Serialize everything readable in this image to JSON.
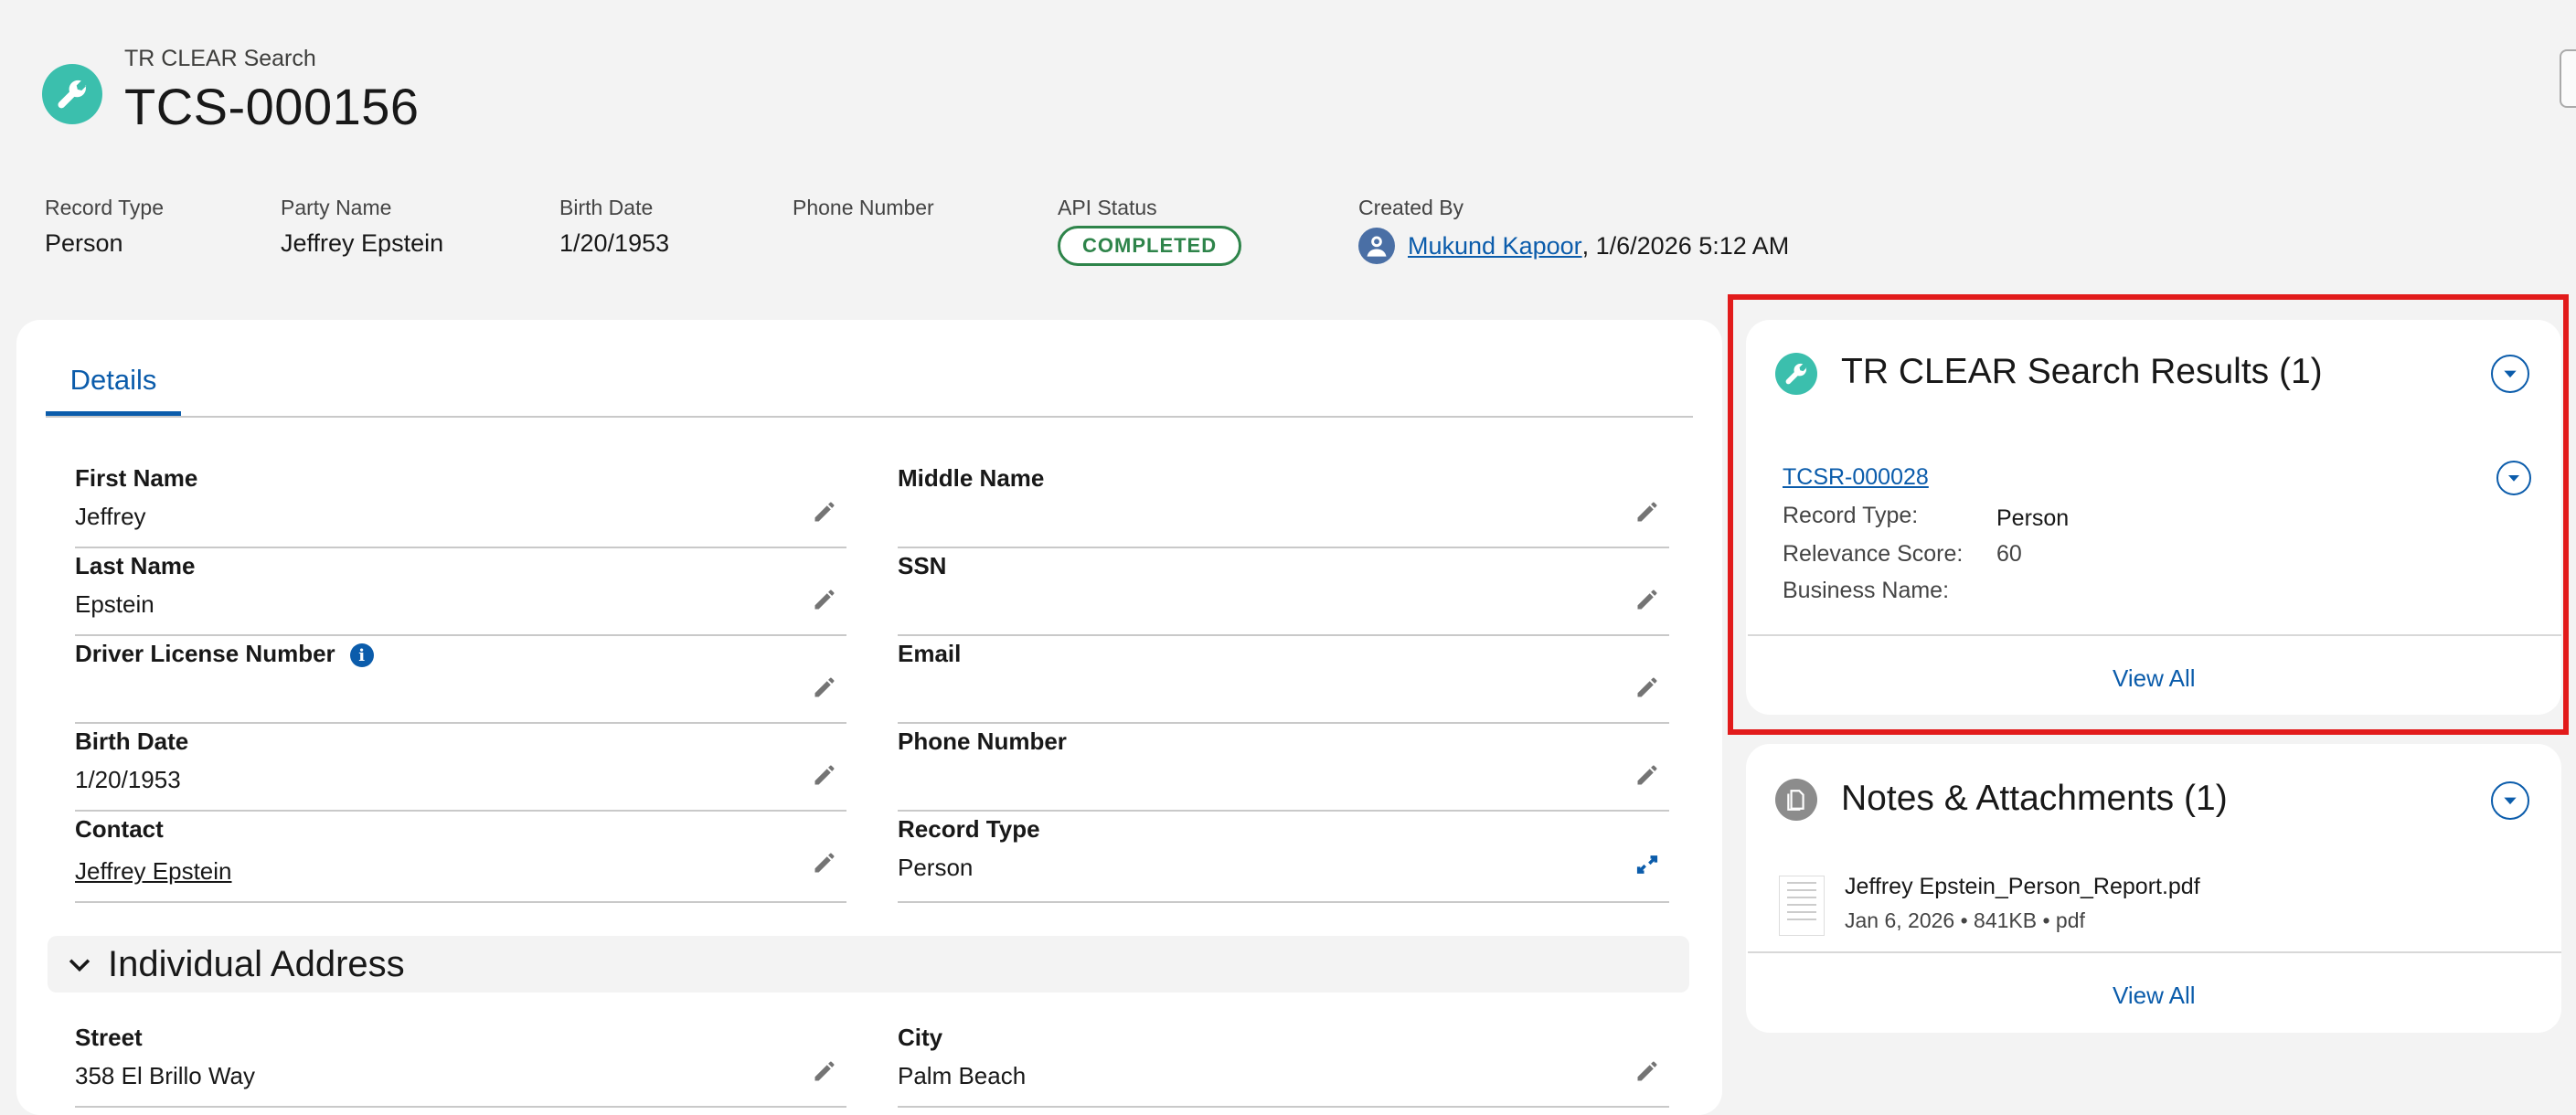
{
  "header": {
    "object_type": "TR CLEAR Search",
    "record_name": "TCS-000156",
    "fields": {
      "record_type": {
        "label": "Record Type",
        "value": "Person"
      },
      "party_name": {
        "label": "Party Name",
        "value": "Jeffrey Epstein"
      },
      "birth_date": {
        "label": "Birth Date",
        "value": "1/20/1953"
      },
      "phone_number": {
        "label": "Phone Number",
        "value": ""
      },
      "api_status": {
        "label": "API Status",
        "value": "COMPLETED"
      },
      "created_by": {
        "label": "Created By",
        "user": "Mukund Kapoor",
        "timestamp": ", 1/6/2026 5:12 AM"
      }
    },
    "icon": "wrench-icon"
  },
  "tabs": [
    {
      "label": "Details",
      "active": true
    }
  ],
  "details": {
    "first_name": {
      "label": "First Name",
      "value": "Jeffrey"
    },
    "middle_name": {
      "label": "Middle Name",
      "value": ""
    },
    "last_name": {
      "label": "Last Name",
      "value": "Epstein"
    },
    "ssn": {
      "label": "SSN",
      "value": ""
    },
    "driver_license": {
      "label": "Driver License Number",
      "value": ""
    },
    "email": {
      "label": "Email",
      "value": ""
    },
    "birth_date": {
      "label": "Birth Date",
      "value": "1/20/1953"
    },
    "phone_number": {
      "label": "Phone Number",
      "value": ""
    },
    "contact": {
      "label": "Contact",
      "value": "Jeffrey Epstein"
    },
    "record_type": {
      "label": "Record Type",
      "value": "Person"
    }
  },
  "address_section": {
    "title": "Individual Address",
    "street": {
      "label": "Street",
      "value": "358 El Brillo Way"
    },
    "city": {
      "label": "City",
      "value": "Palm Beach"
    }
  },
  "search_results": {
    "title": "TR CLEAR Search Results (1)",
    "record": {
      "name": "TCSR-000028",
      "record_type_label": "Record Type:",
      "record_type_value": "Person",
      "relevance_label": "Relevance Score:",
      "relevance_value": "60",
      "business_label": "Business Name:",
      "business_value": ""
    },
    "view_all": "View All"
  },
  "notes": {
    "title": "Notes & Attachments (1)",
    "file": {
      "name": "Jeffrey Epstein_Person_Report.pdf",
      "meta": "Jan 6, 2026 • 841KB • pdf"
    },
    "view_all": "View All"
  },
  "colors": {
    "brand": "#0b5cab",
    "status_green": "#2e844a",
    "teal_icon": "#3bbfad",
    "highlight": "#e21b1b"
  }
}
